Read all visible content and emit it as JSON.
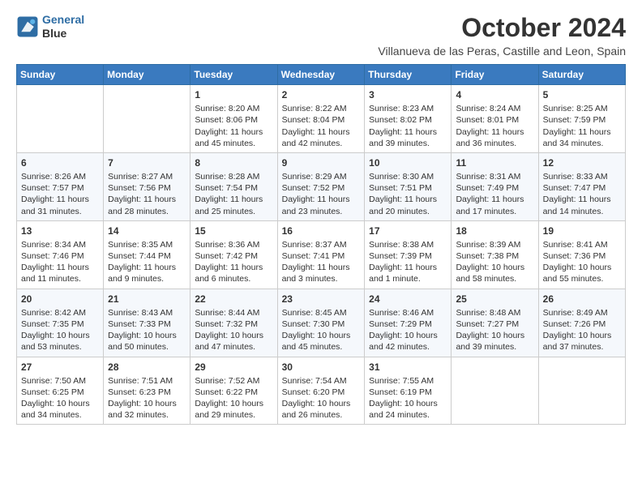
{
  "header": {
    "logo_line1": "General",
    "logo_line2": "Blue",
    "title": "October 2024",
    "subtitle": "Villanueva de las Peras, Castille and Leon, Spain"
  },
  "days_of_week": [
    "Sunday",
    "Monday",
    "Tuesday",
    "Wednesday",
    "Thursday",
    "Friday",
    "Saturday"
  ],
  "weeks": [
    [
      {
        "day": "",
        "info": ""
      },
      {
        "day": "",
        "info": ""
      },
      {
        "day": "1",
        "info": "Sunrise: 8:20 AM\nSunset: 8:06 PM\nDaylight: 11 hours and 45 minutes."
      },
      {
        "day": "2",
        "info": "Sunrise: 8:22 AM\nSunset: 8:04 PM\nDaylight: 11 hours and 42 minutes."
      },
      {
        "day": "3",
        "info": "Sunrise: 8:23 AM\nSunset: 8:02 PM\nDaylight: 11 hours and 39 minutes."
      },
      {
        "day": "4",
        "info": "Sunrise: 8:24 AM\nSunset: 8:01 PM\nDaylight: 11 hours and 36 minutes."
      },
      {
        "day": "5",
        "info": "Sunrise: 8:25 AM\nSunset: 7:59 PM\nDaylight: 11 hours and 34 minutes."
      }
    ],
    [
      {
        "day": "6",
        "info": "Sunrise: 8:26 AM\nSunset: 7:57 PM\nDaylight: 11 hours and 31 minutes."
      },
      {
        "day": "7",
        "info": "Sunrise: 8:27 AM\nSunset: 7:56 PM\nDaylight: 11 hours and 28 minutes."
      },
      {
        "day": "8",
        "info": "Sunrise: 8:28 AM\nSunset: 7:54 PM\nDaylight: 11 hours and 25 minutes."
      },
      {
        "day": "9",
        "info": "Sunrise: 8:29 AM\nSunset: 7:52 PM\nDaylight: 11 hours and 23 minutes."
      },
      {
        "day": "10",
        "info": "Sunrise: 8:30 AM\nSunset: 7:51 PM\nDaylight: 11 hours and 20 minutes."
      },
      {
        "day": "11",
        "info": "Sunrise: 8:31 AM\nSunset: 7:49 PM\nDaylight: 11 hours and 17 minutes."
      },
      {
        "day": "12",
        "info": "Sunrise: 8:33 AM\nSunset: 7:47 PM\nDaylight: 11 hours and 14 minutes."
      }
    ],
    [
      {
        "day": "13",
        "info": "Sunrise: 8:34 AM\nSunset: 7:46 PM\nDaylight: 11 hours and 11 minutes."
      },
      {
        "day": "14",
        "info": "Sunrise: 8:35 AM\nSunset: 7:44 PM\nDaylight: 11 hours and 9 minutes."
      },
      {
        "day": "15",
        "info": "Sunrise: 8:36 AM\nSunset: 7:42 PM\nDaylight: 11 hours and 6 minutes."
      },
      {
        "day": "16",
        "info": "Sunrise: 8:37 AM\nSunset: 7:41 PM\nDaylight: 11 hours and 3 minutes."
      },
      {
        "day": "17",
        "info": "Sunrise: 8:38 AM\nSunset: 7:39 PM\nDaylight: 11 hours and 1 minute."
      },
      {
        "day": "18",
        "info": "Sunrise: 8:39 AM\nSunset: 7:38 PM\nDaylight: 10 hours and 58 minutes."
      },
      {
        "day": "19",
        "info": "Sunrise: 8:41 AM\nSunset: 7:36 PM\nDaylight: 10 hours and 55 minutes."
      }
    ],
    [
      {
        "day": "20",
        "info": "Sunrise: 8:42 AM\nSunset: 7:35 PM\nDaylight: 10 hours and 53 minutes."
      },
      {
        "day": "21",
        "info": "Sunrise: 8:43 AM\nSunset: 7:33 PM\nDaylight: 10 hours and 50 minutes."
      },
      {
        "day": "22",
        "info": "Sunrise: 8:44 AM\nSunset: 7:32 PM\nDaylight: 10 hours and 47 minutes."
      },
      {
        "day": "23",
        "info": "Sunrise: 8:45 AM\nSunset: 7:30 PM\nDaylight: 10 hours and 45 minutes."
      },
      {
        "day": "24",
        "info": "Sunrise: 8:46 AM\nSunset: 7:29 PM\nDaylight: 10 hours and 42 minutes."
      },
      {
        "day": "25",
        "info": "Sunrise: 8:48 AM\nSunset: 7:27 PM\nDaylight: 10 hours and 39 minutes."
      },
      {
        "day": "26",
        "info": "Sunrise: 8:49 AM\nSunset: 7:26 PM\nDaylight: 10 hours and 37 minutes."
      }
    ],
    [
      {
        "day": "27",
        "info": "Sunrise: 7:50 AM\nSunset: 6:25 PM\nDaylight: 10 hours and 34 minutes."
      },
      {
        "day": "28",
        "info": "Sunrise: 7:51 AM\nSunset: 6:23 PM\nDaylight: 10 hours and 32 minutes."
      },
      {
        "day": "29",
        "info": "Sunrise: 7:52 AM\nSunset: 6:22 PM\nDaylight: 10 hours and 29 minutes."
      },
      {
        "day": "30",
        "info": "Sunrise: 7:54 AM\nSunset: 6:20 PM\nDaylight: 10 hours and 26 minutes."
      },
      {
        "day": "31",
        "info": "Sunrise: 7:55 AM\nSunset: 6:19 PM\nDaylight: 10 hours and 24 minutes."
      },
      {
        "day": "",
        "info": ""
      },
      {
        "day": "",
        "info": ""
      }
    ]
  ]
}
